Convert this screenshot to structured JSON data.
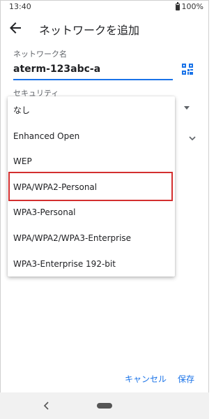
{
  "status_bar": {
    "time": "13:40",
    "battery": "100%"
  },
  "app_bar": {
    "title": "ネットワークを追加"
  },
  "form": {
    "ssid_label": "ネットワーク名",
    "ssid_value": "aterm-123abc-a",
    "security_label": "セキュリティ"
  },
  "security_menu": {
    "options": [
      "なし",
      "Enhanced Open",
      "WEP",
      "WPA/WPA2-Personal",
      "WPA3-Personal",
      "WPA/WPA2/WPA3-Enterprise",
      "WPA3-Enterprise 192-bit"
    ],
    "highlighted_index": 3
  },
  "dialog_buttons": {
    "cancel": "キャンセル",
    "save": "保存"
  },
  "colors": {
    "accent": "#1a73e8",
    "highlight": "#d32f2f"
  },
  "icons": {
    "back": "arrow-back-icon",
    "qr": "qr-code-scan-icon",
    "dropdown": "dropdown-arrow-icon",
    "expand": "chevron-down-icon",
    "battery": "battery-icon",
    "nav_back": "nav-back-icon",
    "nav_home": "nav-home-pill-icon"
  }
}
